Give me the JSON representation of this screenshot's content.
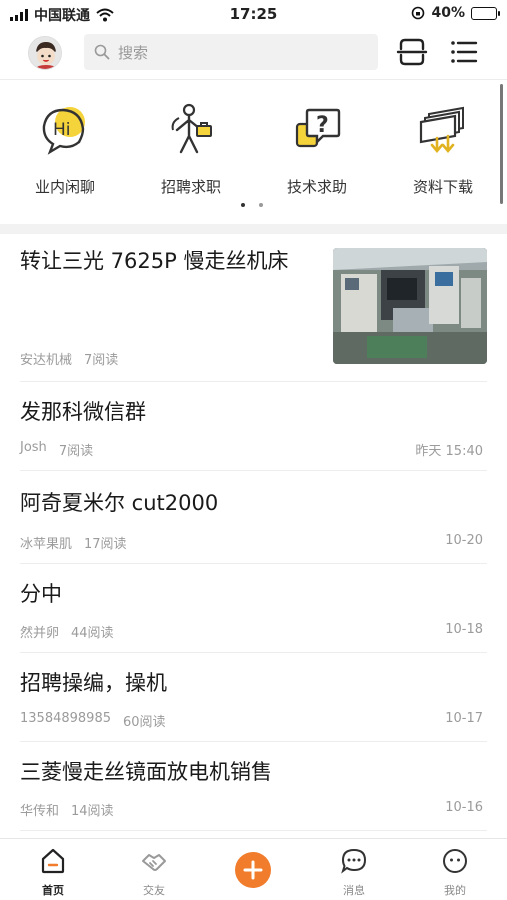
{
  "status_bar": {
    "carrier": "中国联通",
    "time": "17:25",
    "battery": "40%",
    "battery_level": 0.4
  },
  "header": {
    "search_placeholder": "搜索",
    "scan_icon": "scan-icon",
    "menu_icon": "menu-icon"
  },
  "categories": [
    {
      "label": "业内闲聊",
      "icon": "chat-hi-icon"
    },
    {
      "label": "招聘求职",
      "icon": "job-icon"
    },
    {
      "label": "技术求助",
      "icon": "help-question-icon"
    },
    {
      "label": "资料下载",
      "icon": "download-icon"
    }
  ],
  "pager": {
    "pages": 2,
    "active": 0
  },
  "posts": [
    {
      "title": "转让三光 7625P 慢走丝机床",
      "author": "安达机械",
      "reads": "7阅读",
      "date": "",
      "has_image": true
    },
    {
      "title": "发那科微信群",
      "author": "Josh",
      "reads": "7阅读",
      "date": "昨天 15:40"
    },
    {
      "title": "阿奇夏米尔 cut2000",
      "author": "冰苹果肌",
      "reads": "17阅读",
      "date": "10-20"
    },
    {
      "title": "分中",
      "author": "然并卵",
      "reads": "44阅读",
      "date": "10-18"
    },
    {
      "title": "招聘操编，操机",
      "author": "13584898985",
      "reads": "60阅读",
      "date": "10-17"
    },
    {
      "title": "三菱慢走丝镜面放电机销售",
      "author": "华传和",
      "reads": "14阅读",
      "date": "10-16"
    }
  ],
  "tabbar": {
    "tabs": [
      {
        "label": "首页",
        "icon": "home-icon",
        "active": true
      },
      {
        "label": "交友",
        "icon": "handshake-icon",
        "active": false
      },
      {
        "label": "",
        "icon": "plus-icon",
        "active": false
      },
      {
        "label": "消息",
        "icon": "message-icon",
        "active": false
      },
      {
        "label": "我的",
        "icon": "profile-icon",
        "active": false
      }
    ],
    "accent": "#f07c2c"
  }
}
